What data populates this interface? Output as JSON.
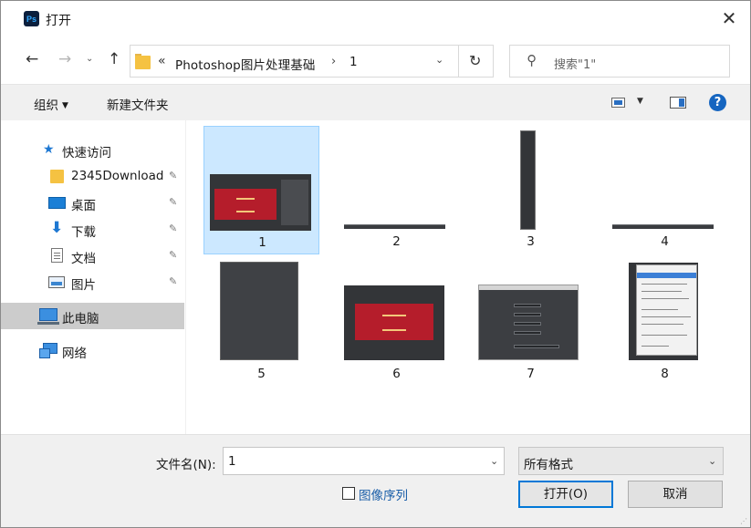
{
  "window": {
    "title": "打开",
    "app_icon": "Ps",
    "close_glyph": "✕"
  },
  "nav": {
    "back": "←",
    "forward": "→",
    "recent": "⌄",
    "up": "↑",
    "breadcrumb_more": "«",
    "breadcrumbs": [
      "Photoshop图片处理基础",
      "1"
    ],
    "crumb_separator": "›",
    "dropdown_glyph": "⌄",
    "refresh_glyph": "↻",
    "search_placeholder": "搜索\"1\""
  },
  "command_bar": {
    "organize": "组织",
    "organize_caret": "▼",
    "new_folder": "新建文件夹",
    "view_caret": "▼",
    "help": "?"
  },
  "sidebar": {
    "items": [
      {
        "label": "快速访问",
        "icon": "star-icon"
      },
      {
        "label": "2345Download",
        "icon": "folder-icon",
        "pinned": true
      },
      {
        "label": "桌面",
        "icon": "desktop-icon",
        "pinned": true
      },
      {
        "label": "下载",
        "icon": "download-icon",
        "pinned": true
      },
      {
        "label": "文档",
        "icon": "document-icon",
        "pinned": true
      },
      {
        "label": "图片",
        "icon": "pictures-icon",
        "pinned": true
      },
      {
        "label": "此电脑",
        "icon": "computer-icon",
        "selected": true
      },
      {
        "label": "网络",
        "icon": "network-icon"
      }
    ],
    "pin_glyph": "📌"
  },
  "files": [
    {
      "name": "1",
      "selected": true
    },
    {
      "name": "2"
    },
    {
      "name": "3"
    },
    {
      "name": "4"
    },
    {
      "name": "5"
    },
    {
      "name": "6"
    },
    {
      "name": "7"
    },
    {
      "name": "8"
    }
  ],
  "bottom": {
    "filename_label": "文件名(N):",
    "filename_value": "1",
    "filetype": "所有格式",
    "image_sequence": "图像序列",
    "open": "打开(O)",
    "cancel": "取消"
  },
  "colors": {
    "accent": "#0078d7",
    "selection": "#cce8ff",
    "ps_brand": "#31a8ff"
  }
}
